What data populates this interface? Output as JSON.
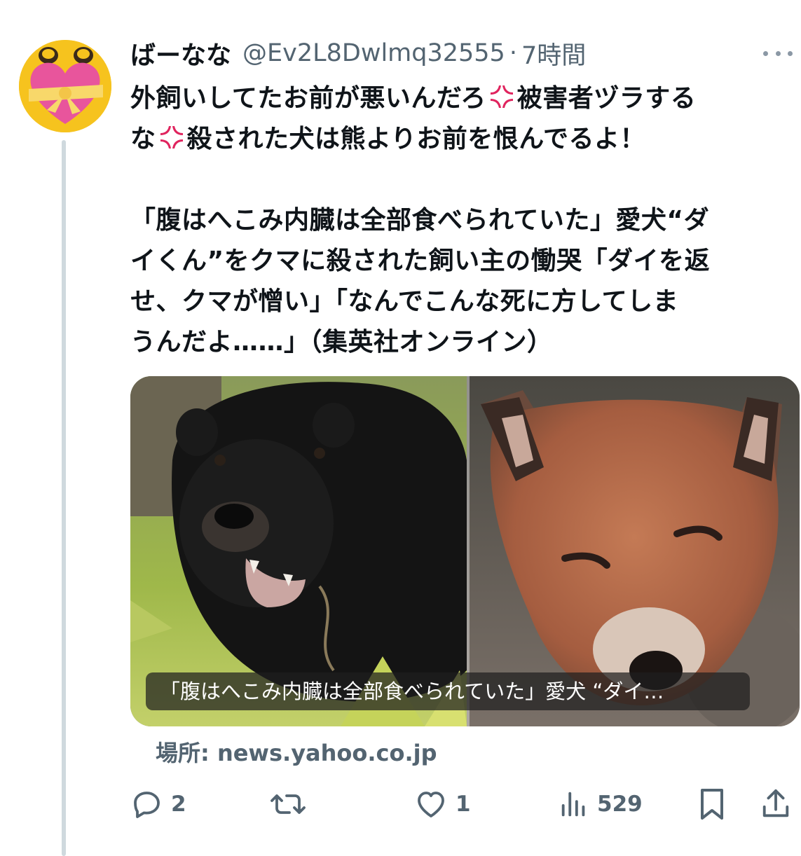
{
  "tweet": {
    "display_name": "ばーなな",
    "handle": "@Ev2L8Dwlmq32555",
    "separator": "·",
    "time": "7時間",
    "text_line1a": "外飼いしてたお前が悪いんだろ",
    "text_line1b": "被害者ヅラする",
    "text_line2a": "な",
    "text_line2b": "殺された犬は熊よりお前を恨んでるよ！",
    "quote_line1": "「腹はへこみ内臓は全部食べられていた」愛犬“ダ",
    "quote_line2": "イくん”をクマに殺された飼い主の慟哭「ダイを返",
    "quote_line3": "せ、クマが憎い」「なんでこんな死に方してしま",
    "quote_line4": "うんだよ……」（集英社オンライン）"
  },
  "card": {
    "caption": "「腹はへこみ内臓は全部食べられていた」愛犬 “ダイ…",
    "source": "場所: news.yahoo.co.jp"
  },
  "actions": {
    "replies": "2",
    "retweets": "",
    "likes": "1",
    "views": "529"
  },
  "colors": {
    "text": "#0f1419",
    "secondary": "#536471",
    "anger": "#e0245e"
  }
}
